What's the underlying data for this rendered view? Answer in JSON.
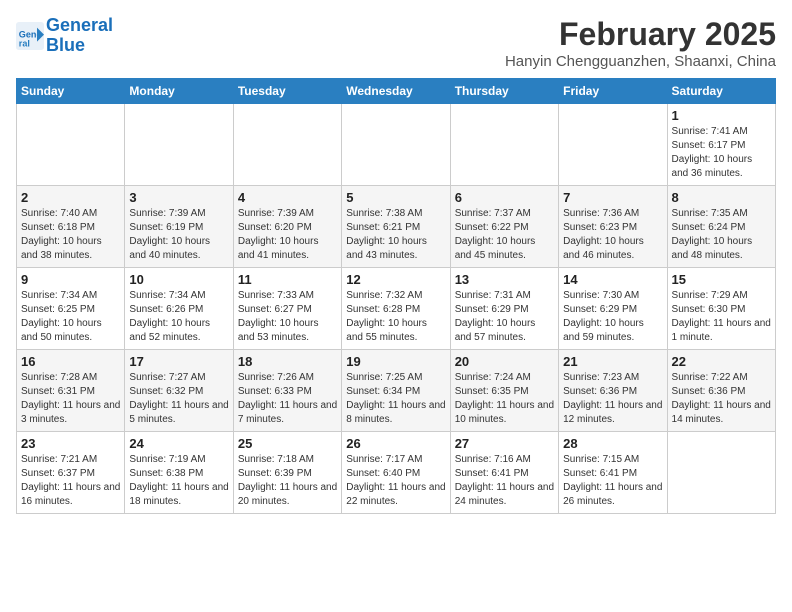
{
  "header": {
    "logo_line1": "General",
    "logo_line2": "Blue",
    "month_title": "February 2025",
    "location": "Hanyin Chengguanzhen, Shaanxi, China"
  },
  "weekdays": [
    "Sunday",
    "Monday",
    "Tuesday",
    "Wednesday",
    "Thursday",
    "Friday",
    "Saturday"
  ],
  "weeks": [
    [
      {
        "day": "",
        "info": ""
      },
      {
        "day": "",
        "info": ""
      },
      {
        "day": "",
        "info": ""
      },
      {
        "day": "",
        "info": ""
      },
      {
        "day": "",
        "info": ""
      },
      {
        "day": "",
        "info": ""
      },
      {
        "day": "1",
        "info": "Sunrise: 7:41 AM\nSunset: 6:17 PM\nDaylight: 10 hours and 36 minutes."
      }
    ],
    [
      {
        "day": "2",
        "info": "Sunrise: 7:40 AM\nSunset: 6:18 PM\nDaylight: 10 hours and 38 minutes."
      },
      {
        "day": "3",
        "info": "Sunrise: 7:39 AM\nSunset: 6:19 PM\nDaylight: 10 hours and 40 minutes."
      },
      {
        "day": "4",
        "info": "Sunrise: 7:39 AM\nSunset: 6:20 PM\nDaylight: 10 hours and 41 minutes."
      },
      {
        "day": "5",
        "info": "Sunrise: 7:38 AM\nSunset: 6:21 PM\nDaylight: 10 hours and 43 minutes."
      },
      {
        "day": "6",
        "info": "Sunrise: 7:37 AM\nSunset: 6:22 PM\nDaylight: 10 hours and 45 minutes."
      },
      {
        "day": "7",
        "info": "Sunrise: 7:36 AM\nSunset: 6:23 PM\nDaylight: 10 hours and 46 minutes."
      },
      {
        "day": "8",
        "info": "Sunrise: 7:35 AM\nSunset: 6:24 PM\nDaylight: 10 hours and 48 minutes."
      }
    ],
    [
      {
        "day": "9",
        "info": "Sunrise: 7:34 AM\nSunset: 6:25 PM\nDaylight: 10 hours and 50 minutes."
      },
      {
        "day": "10",
        "info": "Sunrise: 7:34 AM\nSunset: 6:26 PM\nDaylight: 10 hours and 52 minutes."
      },
      {
        "day": "11",
        "info": "Sunrise: 7:33 AM\nSunset: 6:27 PM\nDaylight: 10 hours and 53 minutes."
      },
      {
        "day": "12",
        "info": "Sunrise: 7:32 AM\nSunset: 6:28 PM\nDaylight: 10 hours and 55 minutes."
      },
      {
        "day": "13",
        "info": "Sunrise: 7:31 AM\nSunset: 6:29 PM\nDaylight: 10 hours and 57 minutes."
      },
      {
        "day": "14",
        "info": "Sunrise: 7:30 AM\nSunset: 6:29 PM\nDaylight: 10 hours and 59 minutes."
      },
      {
        "day": "15",
        "info": "Sunrise: 7:29 AM\nSunset: 6:30 PM\nDaylight: 11 hours and 1 minute."
      }
    ],
    [
      {
        "day": "16",
        "info": "Sunrise: 7:28 AM\nSunset: 6:31 PM\nDaylight: 11 hours and 3 minutes."
      },
      {
        "day": "17",
        "info": "Sunrise: 7:27 AM\nSunset: 6:32 PM\nDaylight: 11 hours and 5 minutes."
      },
      {
        "day": "18",
        "info": "Sunrise: 7:26 AM\nSunset: 6:33 PM\nDaylight: 11 hours and 7 minutes."
      },
      {
        "day": "19",
        "info": "Sunrise: 7:25 AM\nSunset: 6:34 PM\nDaylight: 11 hours and 8 minutes."
      },
      {
        "day": "20",
        "info": "Sunrise: 7:24 AM\nSunset: 6:35 PM\nDaylight: 11 hours and 10 minutes."
      },
      {
        "day": "21",
        "info": "Sunrise: 7:23 AM\nSunset: 6:36 PM\nDaylight: 11 hours and 12 minutes."
      },
      {
        "day": "22",
        "info": "Sunrise: 7:22 AM\nSunset: 6:36 PM\nDaylight: 11 hours and 14 minutes."
      }
    ],
    [
      {
        "day": "23",
        "info": "Sunrise: 7:21 AM\nSunset: 6:37 PM\nDaylight: 11 hours and 16 minutes."
      },
      {
        "day": "24",
        "info": "Sunrise: 7:19 AM\nSunset: 6:38 PM\nDaylight: 11 hours and 18 minutes."
      },
      {
        "day": "25",
        "info": "Sunrise: 7:18 AM\nSunset: 6:39 PM\nDaylight: 11 hours and 20 minutes."
      },
      {
        "day": "26",
        "info": "Sunrise: 7:17 AM\nSunset: 6:40 PM\nDaylight: 11 hours and 22 minutes."
      },
      {
        "day": "27",
        "info": "Sunrise: 7:16 AM\nSunset: 6:41 PM\nDaylight: 11 hours and 24 minutes."
      },
      {
        "day": "28",
        "info": "Sunrise: 7:15 AM\nSunset: 6:41 PM\nDaylight: 11 hours and 26 minutes."
      },
      {
        "day": "",
        "info": ""
      }
    ]
  ]
}
